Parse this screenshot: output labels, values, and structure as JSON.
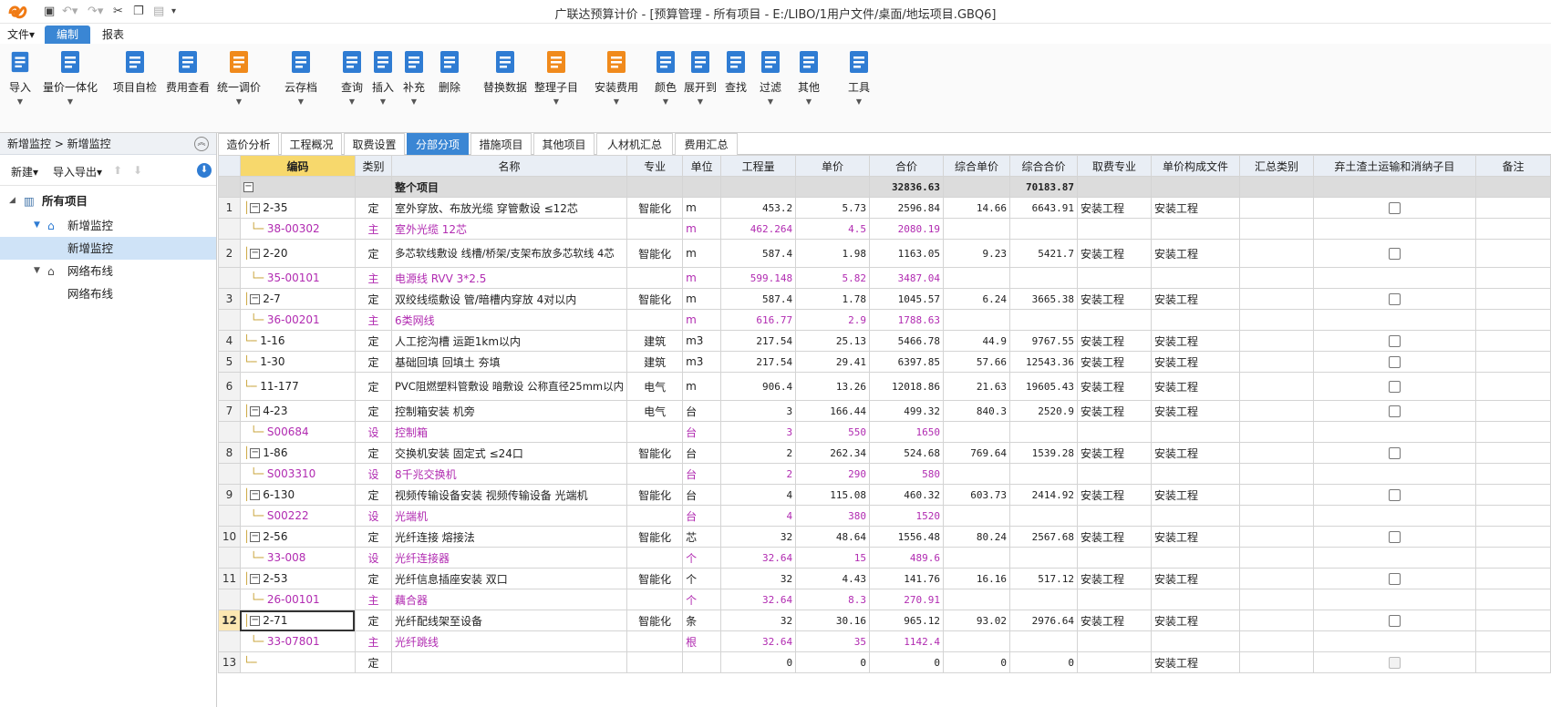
{
  "window": {
    "title": "广联达预算计价 - [预算管理 - 所有项目 - E:/LIBO/1用户文件/桌面/地坛项目.GBQ6]"
  },
  "menu": {
    "file": "文件▾",
    "edit": "编制",
    "report": "报表"
  },
  "ribbon": [
    {
      "label": "导入",
      "icon": "import-icon",
      "color": "#2f7cd3"
    },
    {
      "label": "量价一体化",
      "icon": "integration-icon",
      "color": "#2f7cd3"
    },
    {
      "label": "项目自检",
      "icon": "self-check-icon",
      "color": "#2f7cd3"
    },
    {
      "label": "费用查看",
      "icon": "cost-view-icon",
      "color": "#2f7cd3"
    },
    {
      "label": "统一调价",
      "icon": "price-adjust-icon",
      "color": "#f08a1c"
    },
    {
      "label": "云存档",
      "icon": "cloud-save-icon",
      "color": "#2f7cd3"
    },
    {
      "label": "查询",
      "icon": "query-icon",
      "color": "#2f7cd3"
    },
    {
      "label": "插入",
      "icon": "insert-icon",
      "color": "#2f7cd3"
    },
    {
      "label": "补充",
      "icon": "supplement-icon",
      "color": "#2f7cd3"
    },
    {
      "label": "删除",
      "icon": "delete-icon",
      "color": "#2f7cd3"
    },
    {
      "label": "替换数据",
      "icon": "replace-data-icon",
      "color": "#2f7cd3"
    },
    {
      "label": "整理子目",
      "icon": "organize-icon",
      "color": "#f08a1c"
    },
    {
      "label": "安装费用",
      "icon": "install-cost-icon",
      "color": "#f08a1c"
    },
    {
      "label": "颜色",
      "icon": "color-icon",
      "color": "#2f7cd3"
    },
    {
      "label": "展开到",
      "icon": "expand-icon",
      "color": "#2f7cd3"
    },
    {
      "label": "查找",
      "icon": "find-icon",
      "color": "#2f7cd3"
    },
    {
      "label": "过滤",
      "icon": "filter-icon",
      "color": "#2f7cd3"
    },
    {
      "label": "其他",
      "icon": "other-icon",
      "color": "#2f7cd3"
    },
    {
      "label": "工具",
      "icon": "tools-icon",
      "color": "#2f7cd3"
    }
  ],
  "left": {
    "breadcrumb": "新增监控 > 新增监控",
    "new_label": "新建▾",
    "import_export_label": "导入导出▾",
    "tree": [
      {
        "label": "所有项目",
        "level": 0
      },
      {
        "label": "新增监控",
        "level": 1
      },
      {
        "label": "新增监控",
        "level": 2
      },
      {
        "label": "网络布线",
        "level": 1
      },
      {
        "label": "网络布线",
        "level": 2
      }
    ]
  },
  "tabs": [
    "造价分析",
    "工程概况",
    "取费设置",
    "分部分项",
    "措施项目",
    "其他项目",
    "人材机汇总",
    "费用汇总"
  ],
  "active_tab": "分部分项",
  "columns": [
    "编码",
    "类别",
    "名称",
    "专业",
    "单位",
    "工程量",
    "单价",
    "合价",
    "综合单价",
    "综合合价",
    "取费专业",
    "单价构成文件",
    "汇总类别",
    "弃土渣土运输和消纳子目",
    "备注"
  ],
  "total_row": {
    "name": "整个项目",
    "total": "32836.63",
    "comp_total": "70183.87"
  },
  "rows": [
    {
      "no": "1",
      "code": "2-35",
      "type": "定",
      "name": "室外穿放、布放光缆 穿管敷设 ≤12芯",
      "major": "智能化",
      "unit": "m",
      "qty": "453.2",
      "price": "5.73",
      "total": "2596.84",
      "cprice": "14.66",
      "ctotal": "6643.91",
      "fee": "安装工程",
      "file": "安装工程",
      "sub": false,
      "tree": true
    },
    {
      "no": "",
      "code": "38-00302",
      "type": "主",
      "name": "室外光缆 12芯",
      "major": "",
      "unit": "m",
      "qty": "462.264",
      "price": "4.5",
      "total": "2080.19",
      "cprice": "",
      "ctotal": "",
      "fee": "",
      "file": "",
      "sub": true
    },
    {
      "no": "2",
      "code": "2-20",
      "type": "定",
      "name": "多芯软线敷设 线槽/桥架/支架布放多芯软线 4芯",
      "major": "智能化",
      "unit": "m",
      "qty": "587.4",
      "price": "1.98",
      "total": "1163.05",
      "cprice": "9.23",
      "ctotal": "5421.7",
      "fee": "安装工程",
      "file": "安装工程",
      "sub": false,
      "tree": true,
      "tall": true
    },
    {
      "no": "",
      "code": "35-00101",
      "type": "主",
      "name": "电源线 RVV 3*2.5",
      "major": "",
      "unit": "m",
      "qty": "599.148",
      "price": "5.82",
      "total": "3487.04",
      "cprice": "",
      "ctotal": "",
      "fee": "",
      "file": "",
      "sub": true
    },
    {
      "no": "3",
      "code": "2-7",
      "type": "定",
      "name": "双绞线缆敷设 管/暗槽内穿放 4对以内",
      "major": "智能化",
      "unit": "m",
      "qty": "587.4",
      "price": "1.78",
      "total": "1045.57",
      "cprice": "6.24",
      "ctotal": "3665.38",
      "fee": "安装工程",
      "file": "安装工程",
      "sub": false,
      "tree": true
    },
    {
      "no": "",
      "code": "36-00201",
      "type": "主",
      "name": "6类网线",
      "major": "",
      "unit": "m",
      "qty": "616.77",
      "price": "2.9",
      "total": "1788.63",
      "cprice": "",
      "ctotal": "",
      "fee": "",
      "file": "",
      "sub": true
    },
    {
      "no": "4",
      "code": "1-16",
      "type": "定",
      "name": "人工挖沟槽 运距1km以内",
      "major": "建筑",
      "unit": "m3",
      "qty": "217.54",
      "price": "25.13",
      "total": "5466.78",
      "cprice": "44.9",
      "ctotal": "9767.55",
      "fee": "安装工程",
      "file": "安装工程",
      "sub": false,
      "tree": false
    },
    {
      "no": "5",
      "code": "1-30",
      "type": "定",
      "name": "基础回填 回填土 夯填",
      "major": "建筑",
      "unit": "m3",
      "qty": "217.54",
      "price": "29.41",
      "total": "6397.85",
      "cprice": "57.66",
      "ctotal": "12543.36",
      "fee": "安装工程",
      "file": "安装工程",
      "sub": false,
      "tree": false
    },
    {
      "no": "6",
      "code": "11-177",
      "type": "定",
      "name": "PVC阻燃塑料管敷设 暗敷设 公称直径25mm以内",
      "major": "电气",
      "unit": "m",
      "qty": "906.4",
      "price": "13.26",
      "total": "12018.86",
      "cprice": "21.63",
      "ctotal": "19605.43",
      "fee": "安装工程",
      "file": "安装工程",
      "sub": false,
      "tree": false,
      "tall": true
    },
    {
      "no": "7",
      "code": "4-23",
      "type": "定",
      "name": "控制箱安装 机旁",
      "major": "电气",
      "unit": "台",
      "qty": "3",
      "price": "166.44",
      "total": "499.32",
      "cprice": "840.3",
      "ctotal": "2520.9",
      "fee": "安装工程",
      "file": "安装工程",
      "sub": false,
      "tree": true
    },
    {
      "no": "",
      "code": "S00684",
      "type": "设",
      "name": "控制箱",
      "major": "",
      "unit": "台",
      "qty": "3",
      "price": "550",
      "total": "1650",
      "cprice": "",
      "ctotal": "",
      "fee": "",
      "file": "",
      "sub": true
    },
    {
      "no": "8",
      "code": "1-86",
      "type": "定",
      "name": "交换机安装 固定式 ≤24口",
      "major": "智能化",
      "unit": "台",
      "qty": "2",
      "price": "262.34",
      "total": "524.68",
      "cprice": "769.64",
      "ctotal": "1539.28",
      "fee": "安装工程",
      "file": "安装工程",
      "sub": false,
      "tree": true
    },
    {
      "no": "",
      "code": "S003310",
      "type": "设",
      "name": "8千兆交换机",
      "major": "",
      "unit": "台",
      "qty": "2",
      "price": "290",
      "total": "580",
      "cprice": "",
      "ctotal": "",
      "fee": "",
      "file": "",
      "sub": true
    },
    {
      "no": "9",
      "code": "6-130",
      "type": "定",
      "name": "视频传输设备安装 视频传输设备 光端机",
      "major": "智能化",
      "unit": "台",
      "qty": "4",
      "price": "115.08",
      "total": "460.32",
      "cprice": "603.73",
      "ctotal": "2414.92",
      "fee": "安装工程",
      "file": "安装工程",
      "sub": false,
      "tree": true
    },
    {
      "no": "",
      "code": "S00222",
      "type": "设",
      "name": "光端机",
      "major": "",
      "unit": "台",
      "qty": "4",
      "price": "380",
      "total": "1520",
      "cprice": "",
      "ctotal": "",
      "fee": "",
      "file": "",
      "sub": true
    },
    {
      "no": "10",
      "code": "2-56",
      "type": "定",
      "name": "光纤连接 熔接法",
      "major": "智能化",
      "unit": "芯",
      "qty": "32",
      "price": "48.64",
      "total": "1556.48",
      "cprice": "80.24",
      "ctotal": "2567.68",
      "fee": "安装工程",
      "file": "安装工程",
      "sub": false,
      "tree": true
    },
    {
      "no": "",
      "code": "33-008",
      "type": "设",
      "name": "光纤连接器",
      "major": "",
      "unit": "个",
      "qty": "32.64",
      "price": "15",
      "total": "489.6",
      "cprice": "",
      "ctotal": "",
      "fee": "",
      "file": "",
      "sub": true
    },
    {
      "no": "11",
      "code": "2-53",
      "type": "定",
      "name": "光纤信息插座安装 双口",
      "major": "智能化",
      "unit": "个",
      "qty": "32",
      "price": "4.43",
      "total": "141.76",
      "cprice": "16.16",
      "ctotal": "517.12",
      "fee": "安装工程",
      "file": "安装工程",
      "sub": false,
      "tree": true
    },
    {
      "no": "",
      "code": "26-00101",
      "type": "主",
      "name": "藕合器",
      "major": "",
      "unit": "个",
      "qty": "32.64",
      "price": "8.3",
      "total": "270.91",
      "cprice": "",
      "ctotal": "",
      "fee": "",
      "file": "",
      "sub": true
    },
    {
      "no": "12",
      "code": "2-71",
      "type": "定",
      "name": "光纤配线架至设备",
      "major": "智能化",
      "unit": "条",
      "qty": "32",
      "price": "30.16",
      "total": "965.12",
      "cprice": "93.02",
      "ctotal": "2976.64",
      "fee": "安装工程",
      "file": "安装工程",
      "sub": false,
      "tree": true,
      "current": true
    },
    {
      "no": "",
      "code": "33-07801",
      "type": "主",
      "name": "光纤跳线",
      "major": "",
      "unit": "根",
      "qty": "32.64",
      "price": "35",
      "total": "1142.4",
      "cprice": "",
      "ctotal": "",
      "fee": "",
      "file": "",
      "sub": true
    },
    {
      "no": "13",
      "code": "",
      "type": "定",
      "name": "",
      "major": "",
      "unit": "",
      "qty": "0",
      "price": "0",
      "total": "0",
      "cprice": "0",
      "ctotal": "0",
      "fee": "",
      "file": "安装工程",
      "sub": false,
      "tree": false,
      "disabled": true
    }
  ]
}
